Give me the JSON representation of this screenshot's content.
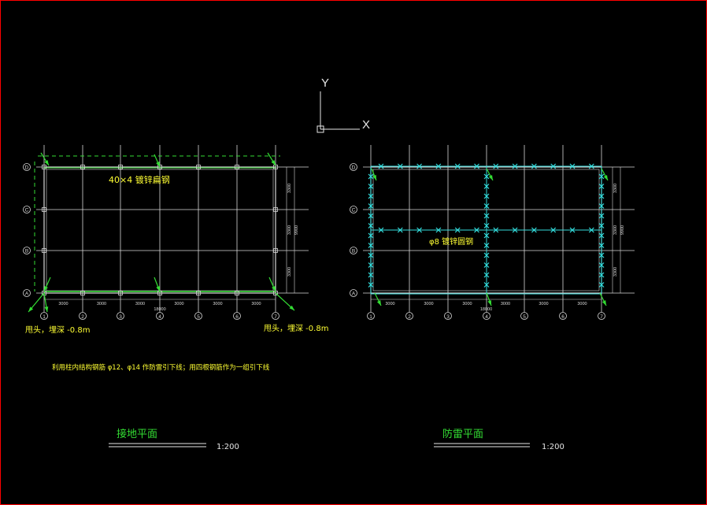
{
  "ucs": {
    "y_label": "Y",
    "x_label": "X"
  },
  "left_plan": {
    "row_labels": [
      "D",
      "C",
      "B",
      "A"
    ],
    "col_labels": [
      "1",
      "2",
      "3",
      "4",
      "5",
      "6",
      "7"
    ],
    "bay_dims": [
      "3000",
      "3000",
      "3000",
      "3000",
      "3000",
      "3000"
    ],
    "total_width": "18000",
    "row_dims": [
      "3300",
      "3300",
      "3300"
    ],
    "total_depth": "9900",
    "steel_note": "40×4 镀锌扁钢",
    "tail_note_left": "甩头，埋深 -0.8m",
    "tail_note_right": "甩头，埋深 -0.8m",
    "downconductor_note": "利用柱内结构钢筋 φ12、φ14 作防雷引下线；用四根钢筋作为一组引下线",
    "title": "接地平面",
    "scale": "1:200"
  },
  "right_plan": {
    "row_labels": [
      "D",
      "C",
      "B",
      "A"
    ],
    "col_labels": [
      "1",
      "2",
      "3",
      "4",
      "5",
      "6",
      "7"
    ],
    "bay_dims": [
      "3000",
      "3000",
      "3000",
      "3000",
      "3000",
      "3000"
    ],
    "total_width": "18000",
    "row_dims": [
      "3300",
      "3300",
      "3300"
    ],
    "total_depth": "9900",
    "rod_note": "φ8 镀锌圆钢",
    "title": "防雷平面",
    "scale": "1:200"
  },
  "colors": {
    "background": "#000000",
    "frame": "#ff0000",
    "grid": "#d8d8d8",
    "grounding": "#33dd33",
    "lightning_net": "#33dddd",
    "note": "#ffff33"
  }
}
